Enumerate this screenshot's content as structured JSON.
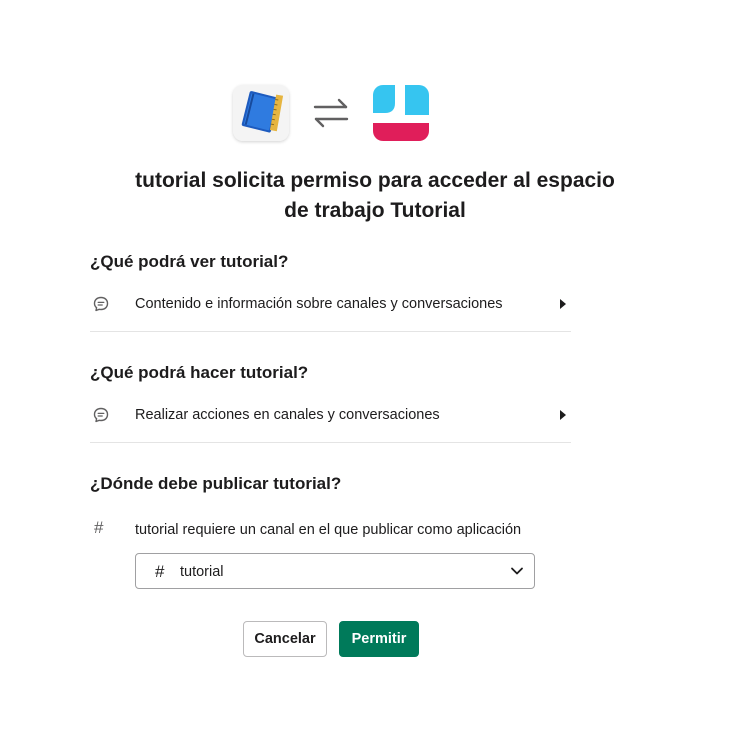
{
  "header": {
    "app_icon": "notebook-app-icon",
    "swap_icon": "swap-arrows-icon",
    "workspace_icon": "workspace-logo-icon",
    "title_line1": "tutorial solicita permiso para acceder al espacio",
    "title_line2": "de trabajo Tutorial"
  },
  "sections": {
    "see": {
      "heading": "¿Qué podrá ver tutorial?",
      "item": "Contenido e información sobre canales y conversaciones",
      "icon": "chat-bubble-icon"
    },
    "do": {
      "heading": "¿Qué podrá hacer tutorial?",
      "item": "Realizar acciones en canales y conversaciones",
      "icon": "chat-bubble-icon"
    },
    "post": {
      "heading": "¿Dónde debe publicar tutorial?",
      "note": "tutorial requiere un canal en el que publicar como aplicación",
      "hash": "#",
      "selected_channel": "tutorial"
    }
  },
  "actions": {
    "cancel_label": "Cancelar",
    "allow_label": "Permitir"
  },
  "colors": {
    "primary": "#007a5a",
    "text": "#1d1c1d",
    "workspace_blue": "#36c5f0",
    "workspace_red": "#e01e5a"
  }
}
